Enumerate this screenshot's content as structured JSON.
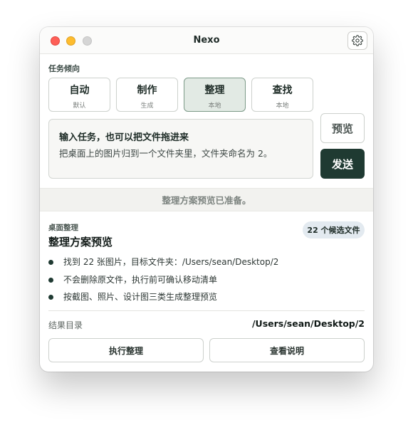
{
  "window": {
    "title": "Nexo"
  },
  "intent": {
    "label": "任务倾向",
    "modes": [
      {
        "title": "自动",
        "subtitle": "默认",
        "selected": false
      },
      {
        "title": "制作",
        "subtitle": "生成",
        "selected": false
      },
      {
        "title": "整理",
        "subtitle": "本地",
        "selected": true
      },
      {
        "title": "查找",
        "subtitle": "本地",
        "selected": false
      }
    ]
  },
  "task": {
    "heading": "输入任务，也可以把文件拖进来",
    "value": "把桌面上的图片归到一个文件夹里，文件夹命名为 2。"
  },
  "buttons": {
    "preview": "预览",
    "send": "发送"
  },
  "status": "整理方案预览已准备。",
  "plan": {
    "category": "桌面整理",
    "title": "整理方案预览",
    "badge": "22 个候选文件",
    "bullets": [
      "找到 22 张图片，目标文件夹：/Users/sean/Desktop/2",
      "不会删除原文件，执行前可确认移动清单",
      "按截图、照片、设计图三类生成整理预览"
    ],
    "result_label": "结果目录",
    "result_path": "/Users/sean/Desktop/2",
    "run_button": "执行整理",
    "doc_button": "查看说明"
  },
  "icons": {
    "settings": "gear-icon"
  },
  "colors": {
    "accent": "#1f3a32",
    "selected_bg": "#e2eae4",
    "badge_bg": "#e3eaf0",
    "traffic_red": "#fe5f57",
    "traffic_yellow": "#febc2e",
    "traffic_gray": "#d5d5d5"
  }
}
